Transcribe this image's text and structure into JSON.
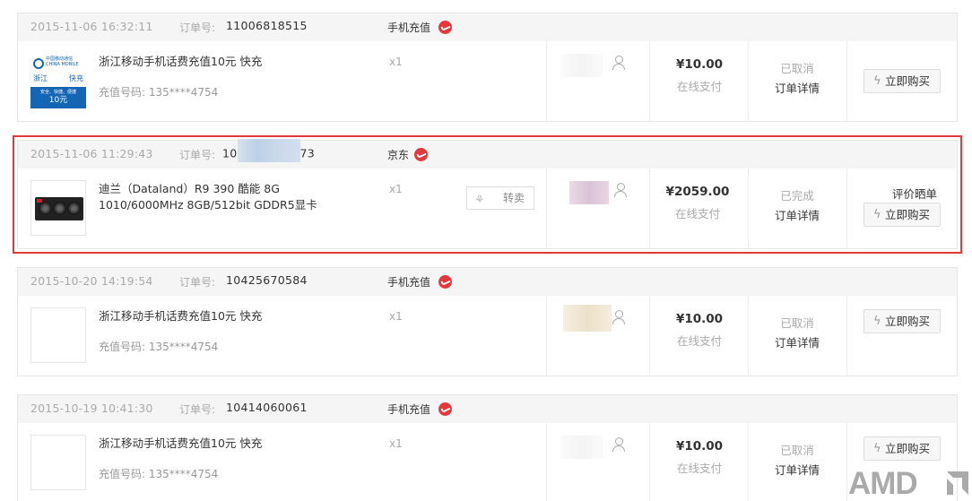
{
  "orders": [
    {
      "date": "2015-11-06 16:32:11",
      "order_label": "订单号:",
      "order_no": "11006818515",
      "order_no_prefix": "",
      "order_no_suffix": "",
      "shop": "手机充值",
      "product_name": "浙江移动手机话费充值10元 快充",
      "product_sub": "充值号码: 135****4754",
      "qty": "x1",
      "amount": "¥10.00",
      "pay_method": "在线支付",
      "status": "已取消",
      "detail_link": "订单详情",
      "review_link": "",
      "buy_label": "立即购买",
      "thumb_text": {
        "brand": "中国移动通信 CHINA MOBILE",
        "region": "浙江",
        "speed": "快充",
        "tagline": "安全、快捷、便捷",
        "value": "10元"
      }
    },
    {
      "date": "2015-11-06 11:29:43",
      "order_label": "订单号:",
      "order_no": "",
      "order_no_prefix": "10",
      "order_no_suffix": "73",
      "shop": "京东",
      "product_name": "迪兰（Dataland）R9 390 酷能 8G 1010/6000MHz 8GB/512bit GDDR5显卡",
      "product_sub": "",
      "qty": "x1",
      "resale_label": "转卖",
      "amount": "¥2059.00",
      "pay_method": "在线支付",
      "status": "已完成",
      "detail_link": "订单详情",
      "review_link": "评价晒单",
      "buy_label": "立即购买"
    },
    {
      "date": "2015-10-20 14:19:54",
      "order_label": "订单号:",
      "order_no": "10425670584",
      "order_no_prefix": "",
      "order_no_suffix": "",
      "shop": "手机充值",
      "product_name": "浙江移动手机话费充值10元 快充",
      "product_sub": "充值号码: 135****4754",
      "qty": "x1",
      "amount": "¥10.00",
      "pay_method": "在线支付",
      "status": "已取消",
      "detail_link": "订单详情",
      "review_link": "",
      "buy_label": "立即购买"
    },
    {
      "date": "2015-10-19 10:41:30",
      "order_label": "订单号:",
      "order_no": "10414060061",
      "order_no_prefix": "",
      "order_no_suffix": "",
      "shop": "手机充值",
      "product_name": "浙江移动手机话费充值10元 快充",
      "product_sub": "充值号码: 135****4754",
      "qty": "x1",
      "amount": "¥10.00",
      "pay_method": "在线支付",
      "status": "已取消",
      "detail_link": "订单详情",
      "review_link": "",
      "buy_label": "立即购买"
    }
  ],
  "watermark": "AMD",
  "colors": {
    "accent": "#e4393c",
    "header_bg": "#f5f5f5",
    "muted": "#aaaaaa",
    "border": "#e6e6e6",
    "mobile_blue": "#1565b5"
  },
  "icons": {
    "shop": "jd-red-icon",
    "person": "user-icon",
    "buy": "lightning-icon",
    "resale": "handshake-icon"
  }
}
